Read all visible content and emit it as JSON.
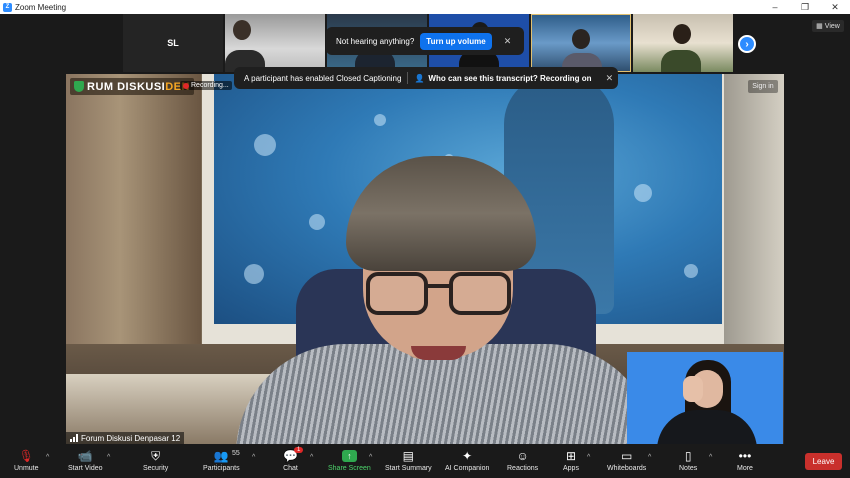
{
  "window": {
    "title": "Zoom Meeting",
    "app_logo": "Z",
    "controls": [
      "–",
      "❐",
      "✕"
    ]
  },
  "gallery": {
    "tiles": [
      {
        "initials": "SL",
        "type": "avatar"
      },
      {
        "initials": "",
        "type": "video"
      },
      {
        "initials": "",
        "type": "video"
      },
      {
        "initials": "",
        "type": "video"
      },
      {
        "initials": "",
        "type": "video"
      },
      {
        "initials": "",
        "type": "video"
      }
    ],
    "next_icon": "›"
  },
  "view_button": {
    "label": "View",
    "icon": "grid-icon"
  },
  "notifications": {
    "volume": {
      "text": "Not hearing anything?",
      "action": "Turn up volume",
      "close": "✕"
    },
    "captions": {
      "text": "A participant has enabled Closed Captioning",
      "link": "Who can see this transcript? Recording on",
      "close": "✕"
    }
  },
  "main_video": {
    "logo_text_1": "RUM DISKUSI",
    "logo_text_2": "DEN",
    "recording_label": "Recording...",
    "sign_in": "Sign in",
    "participant_name": "Forum Diskusi Denpasar 12"
  },
  "toolbar": {
    "unmute": "Unmute",
    "start_video": "Start Video",
    "security": "Security",
    "participants": "Participants",
    "participants_count": "55",
    "chat": "Chat",
    "chat_badge": "1",
    "share_screen": "Share Screen",
    "start_summary": "Start Summary",
    "ai_companion": "AI Companion",
    "reactions": "Reactions",
    "apps": "Apps",
    "whiteboards": "Whiteboards",
    "notes": "Notes",
    "more": "More",
    "leave": "Leave"
  },
  "colors": {
    "accent": "#0e72ed",
    "leave": "#c9302c",
    "share": "#2fa84f",
    "background": "#1a1a1a"
  }
}
